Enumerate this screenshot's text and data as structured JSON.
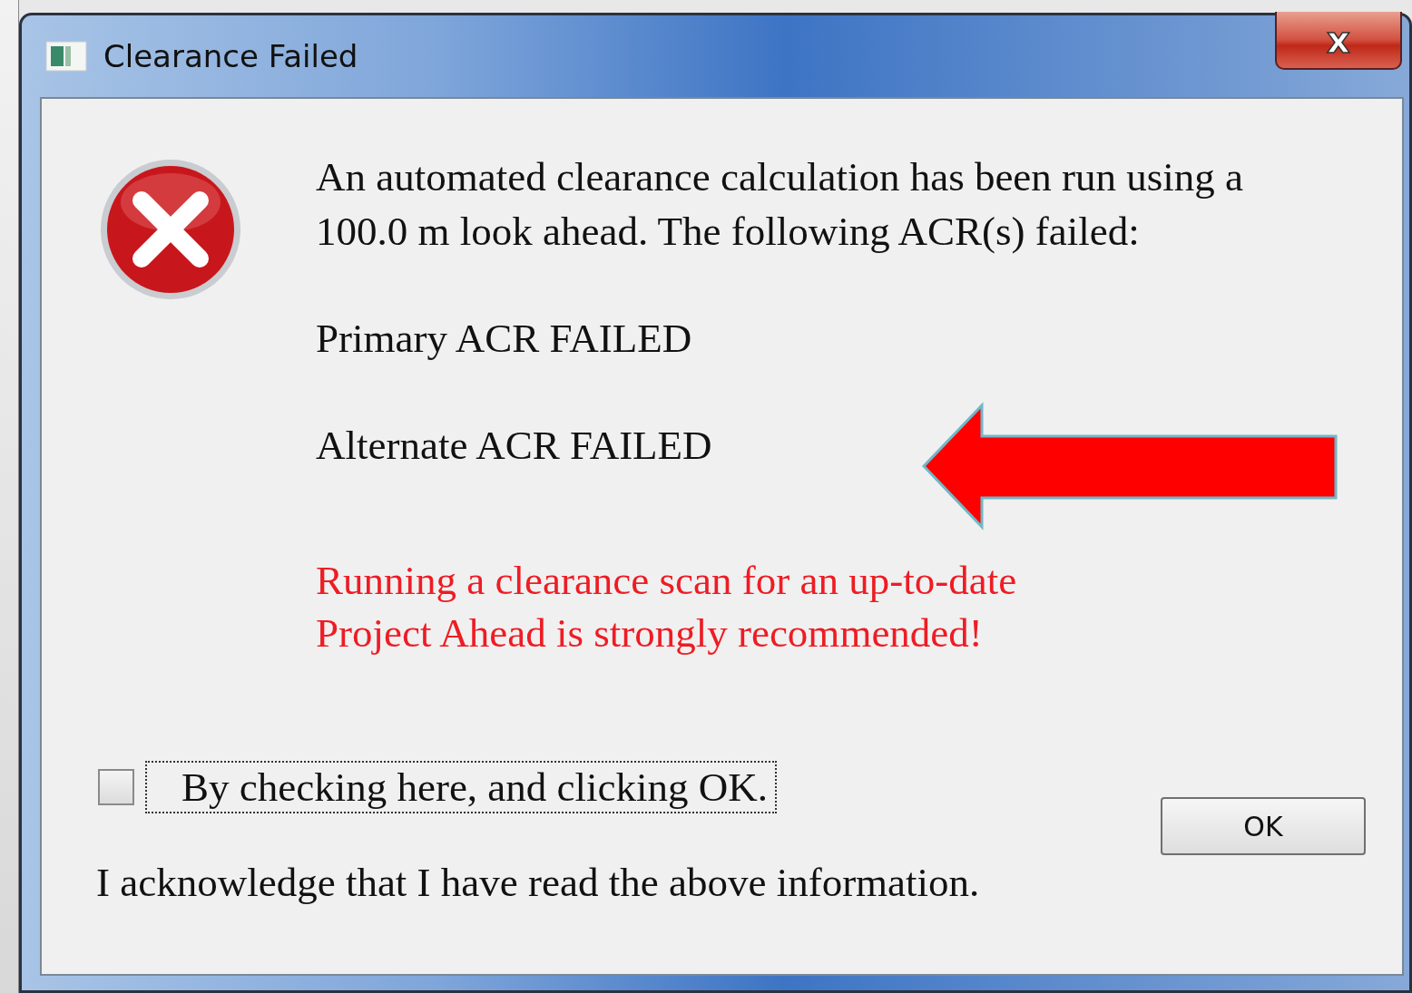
{
  "window": {
    "title": "Clearance Failed",
    "close_glyph": "x"
  },
  "message": "An automated clearance calculation has been run using a 100.0 m look ahead.  The following ACR(s) failed:",
  "results": [
    "Primary ACR FAILED",
    "Alternate ACR FAILED"
  ],
  "warning": "Running a clearance scan for an up-to-date Project Ahead is strongly recommended!",
  "acknowledge_checkbox": {
    "label": "By checking here, and clicking OK.",
    "checked": false
  },
  "acknowledgement": "I acknowledge that I have read the above information.",
  "ok_button": "OK"
}
